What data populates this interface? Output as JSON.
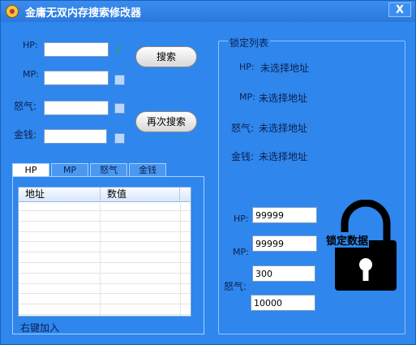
{
  "window": {
    "title": "金庸无双内存搜索修改器",
    "close_glyph": "X"
  },
  "search": {
    "hp_label": "HP:",
    "mp_label": "MP:",
    "rage_label": "怒气:",
    "money_label": "金钱:",
    "hp_value": "",
    "mp_value": "",
    "rage_value": "",
    "money_value": "",
    "hp_checked": true,
    "mp_checked": false,
    "rage_checked": false,
    "money_checked": false,
    "search_button": "搜索",
    "research_button": "再次搜索"
  },
  "tabs": [
    {
      "label": "HP",
      "active": true
    },
    {
      "label": "MP",
      "active": false
    },
    {
      "label": "怒气",
      "active": false
    },
    {
      "label": "金钱",
      "active": false
    }
  ],
  "list": {
    "columns": [
      "地址",
      "数值"
    ],
    "rows": [],
    "footer": "右键加入"
  },
  "lock_group": {
    "title": "锁定列表",
    "hp_label": "HP:",
    "hp_status": "未选择地址",
    "mp_label": "MP:",
    "mp_status": "未选择地址",
    "rage_label": "怒气:",
    "rage_status": "未选择地址",
    "money_label": "金钱:",
    "money_status": "未选择地址"
  },
  "lock_values": {
    "hp_label": "HP:",
    "hp_value": "99999",
    "mp_label": "MP:",
    "mp_value": "99999",
    "rage_label": "怒气:",
    "rage_value": "300",
    "money_value": "10000",
    "lock_caption": "锁定数据"
  },
  "colors": {
    "background": "#2f86ec",
    "label_text": "#0b2050",
    "check_green": "#2ea84a"
  },
  "icons": {
    "app": "app-icon",
    "check": "check-icon",
    "lock": "padlock-icon"
  }
}
